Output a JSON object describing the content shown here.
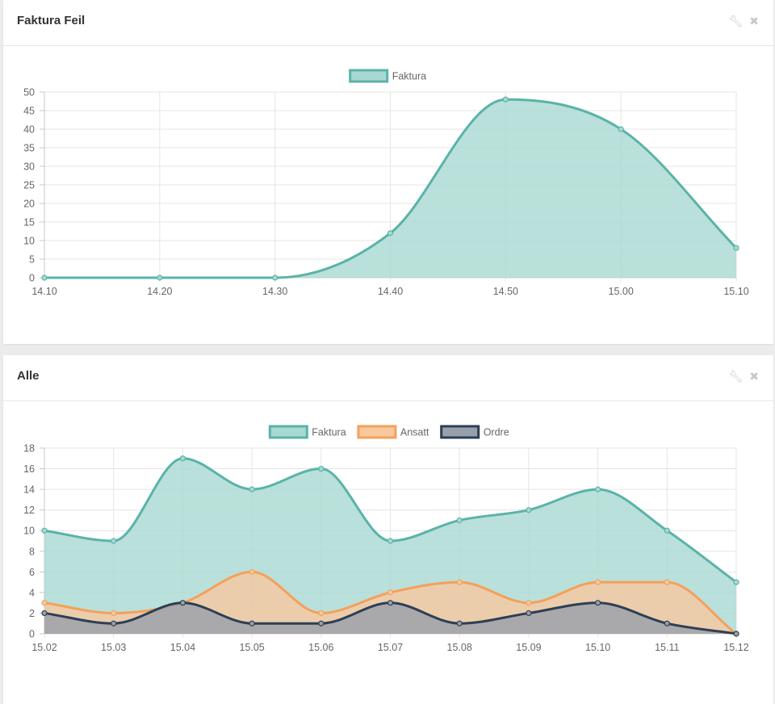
{
  "panels": [
    {
      "title": "Faktura Feil",
      "tools": {
        "settings_icon": "wrench-icon",
        "close_icon": "close-icon"
      }
    },
    {
      "title": "Alle",
      "tools": {
        "settings_icon": "wrench-icon",
        "close_icon": "close-icon"
      }
    }
  ],
  "chart_data": [
    {
      "type": "area",
      "title": "",
      "categories": [
        "14.10",
        "14.20",
        "14.30",
        "14.40",
        "14.50",
        "15.00",
        "15.10"
      ],
      "y_ticks": [
        0,
        5,
        10,
        15,
        20,
        25,
        30,
        35,
        40,
        45,
        50
      ],
      "ylim": [
        0,
        50
      ],
      "grid": true,
      "legend_position": "top",
      "series": [
        {
          "name": "Faktura",
          "values": [
            0,
            0,
            0,
            12,
            48,
            40,
            8
          ],
          "color": "#5ab3a8",
          "fill": "#a9d8d2"
        }
      ]
    },
    {
      "type": "area",
      "title": "",
      "categories": [
        "15.02",
        "15.03",
        "15.04",
        "15.05",
        "15.06",
        "15.07",
        "15.08",
        "15.09",
        "15.10",
        "15.11",
        "15.12"
      ],
      "y_ticks": [
        0,
        2,
        4,
        6,
        8,
        10,
        12,
        14,
        16,
        18
      ],
      "ylim": [
        0,
        18
      ],
      "grid": true,
      "legend_position": "top",
      "series": [
        {
          "name": "Faktura",
          "values": [
            10,
            9,
            17,
            14,
            16,
            9,
            11,
            12,
            14,
            10,
            5
          ],
          "color": "#5ab3a8",
          "fill": "#a9d8d2"
        },
        {
          "name": "Ansatt",
          "values": [
            3,
            2,
            3,
            6,
            2,
            4,
            5,
            3,
            5,
            5,
            0
          ],
          "color": "#f5a05a",
          "fill": "#f8c8a0"
        },
        {
          "name": "Ordre",
          "values": [
            2,
            1,
            3,
            1,
            1,
            3,
            1,
            2,
            3,
            1,
            0
          ],
          "color": "#2d3f55",
          "fill": "#98a0ab"
        }
      ]
    }
  ]
}
